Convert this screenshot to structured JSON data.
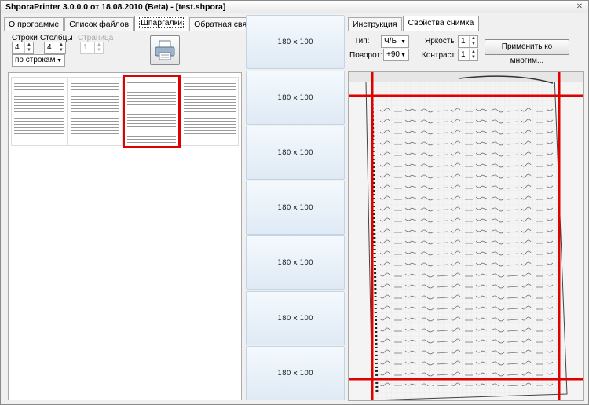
{
  "window": {
    "title": "ShporaPrinter 3.0.0.0 от 18.08.2010 (Beta) - [test.shpora]",
    "close_glyph": "✕"
  },
  "left_tabs": [
    "О программе",
    "Список файлов",
    "Шпаргалки",
    "Обратная связь"
  ],
  "left_active_tab": 2,
  "controls": {
    "rows_label": "Строки",
    "rows_value": "4",
    "cols_label": "Столбцы",
    "cols_value": "4",
    "page_label": "Страница",
    "page_value": "1",
    "order_value": "по строкам"
  },
  "print_icon": "printer-icon",
  "thumbnails": [
    {
      "name": "sheet-1",
      "selected": false
    },
    {
      "name": "sheet-2",
      "selected": false
    },
    {
      "name": "sheet-3",
      "selected": true
    },
    {
      "name": "sheet-4",
      "selected": false
    }
  ],
  "slots": [
    "180 x 100",
    "180 x 100",
    "180 x 100",
    "180 x 100",
    "180 x 100",
    "180 x 100",
    "180 x 100"
  ],
  "right_tabs": [
    "Инструкция",
    "Свойства снимка"
  ],
  "right_active_tab": 1,
  "props": {
    "type_label": "Тип:",
    "type_value": "Ч/Б",
    "rotate_label": "Поворот:",
    "rotate_value": "+90",
    "brightness_label": "Яркость",
    "brightness_value": "1",
    "contrast_label": "Контраст",
    "contrast_value": "1",
    "apply_button": "Применить ко многим..."
  },
  "colors": {
    "selection": "#e00000",
    "crop_lines": "#e00000"
  }
}
